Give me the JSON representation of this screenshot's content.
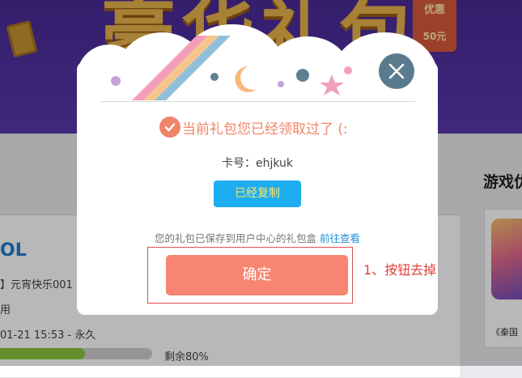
{
  "background": {
    "banner_title": "豪华礼包",
    "promo_tag": {
      "label": "优惠",
      "amount": "50元"
    },
    "gift_title": "OL",
    "gift_name": "】元宵快乐001",
    "gift_usage": "用",
    "gift_validity": "01-21 15:53 - 永久",
    "progress_fraction": 0.58,
    "remaining_label": "剩余80%",
    "right_heading": "游戏优",
    "right_caption": "《秦国"
  },
  "modal": {
    "status_text": "当前礼包您已经领取过了 (:",
    "card_label": "卡号：ehjkuk",
    "copy_button": "已经复制",
    "saved_text": "您的礼包已保存到用户中心的礼包盒",
    "saved_link": "前往查看",
    "confirm_button": "确定"
  },
  "annotation": {
    "note": "1、按钮去掉",
    "color": "#e0413a"
  },
  "colors": {
    "accent": "#f0846a",
    "confirm": "#f88572",
    "copy_button": "#1eaef0",
    "close_button": "#5a7b8e"
  }
}
